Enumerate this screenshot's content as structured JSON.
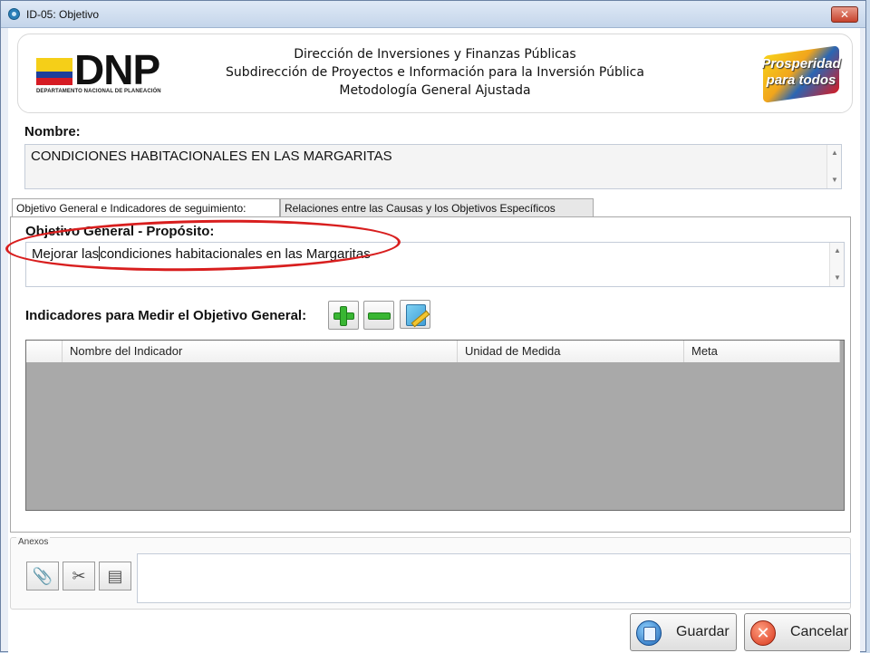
{
  "window": {
    "title": "ID-05: Objetivo",
    "close_symbol": "✕",
    "app_icon": "app-icon"
  },
  "header": {
    "logo_text": "DNP",
    "logo_subtitle": "DEPARTAMENTO NACIONAL DE PLANEACIÓN",
    "line1": "Dirección de Inversiones y Finanzas Públicas",
    "line2": "Subdirección de Proyectos e Información para la Inversión Pública",
    "line3": "Metodología General Ajustada",
    "slogan_line1": "Prosperidad",
    "slogan_line2": "para todos"
  },
  "nombre": {
    "label": "Nombre:",
    "value": "CONDICIONES HABITACIONALES EN LAS MARGARITAS"
  },
  "tabs": [
    {
      "label": "Objetivo General e Indicadores de seguimiento:",
      "active": true
    },
    {
      "label": "Relaciones entre las Causas y los Objetivos Específicos",
      "active": false
    }
  ],
  "objetivo": {
    "label": "Objetivo General - Propósito:",
    "value_before_caret": "Mejorar las",
    "value_after_caret": "condiciones habitacionales en las Margaritas",
    "highlight_color": "#d81e1e"
  },
  "indicadores": {
    "label": "Indicadores para Medir el Objetivo General:",
    "toolbar": [
      "add-icon",
      "remove-icon",
      "edit-icon"
    ],
    "columns": [
      "",
      "Nombre del Indicador",
      "Unidad de Medida",
      "Meta"
    ],
    "rows": []
  },
  "anexos": {
    "label": "Anexos",
    "buttons": [
      "paperclip-icon",
      "scissors-icon",
      "document-icon"
    ],
    "value": ""
  },
  "actions": {
    "save_label": "Guardar",
    "cancel_label": "Cancelar",
    "cancel_symbol": "✕"
  }
}
